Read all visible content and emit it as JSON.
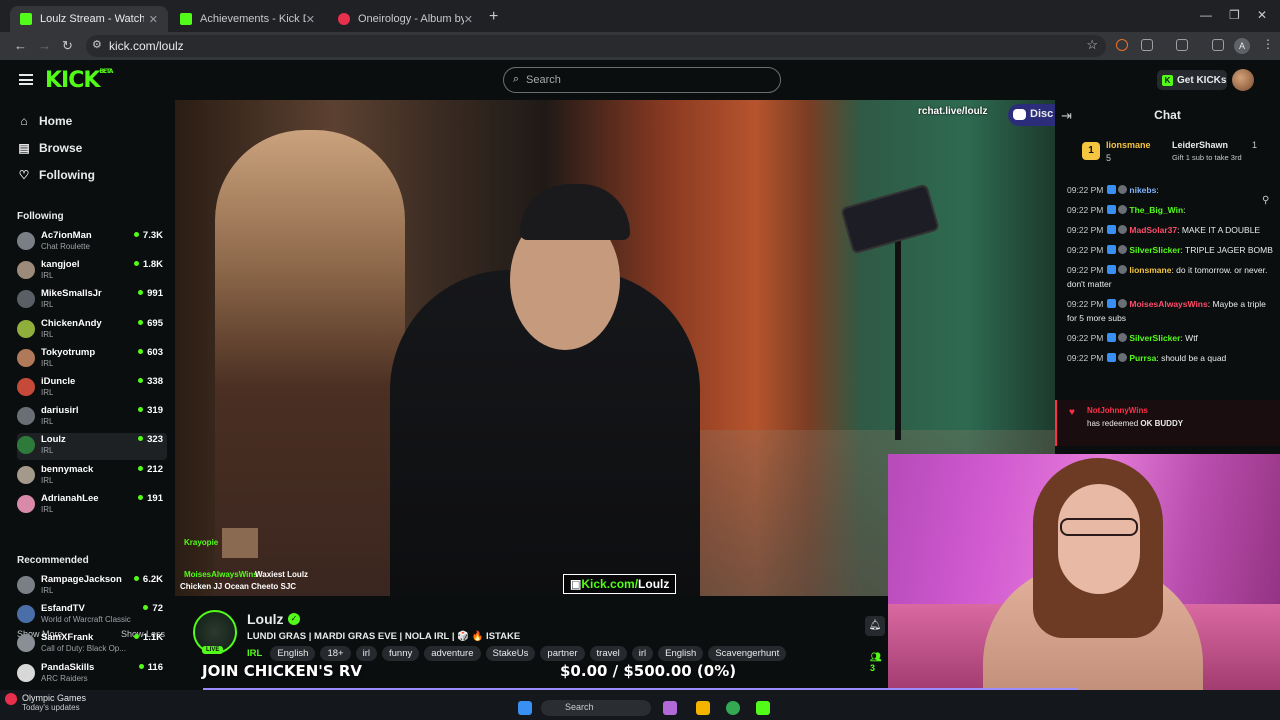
{
  "browser": {
    "tabs": [
      {
        "title": "Loulz Stream - Watch Live on Kick",
        "active": true,
        "favicon_color": "#53fc18"
      },
      {
        "title": "Achievements - Kick Dashboard",
        "active": false,
        "favicon_color": "#53fc18"
      },
      {
        "title": "Oneirology - Album by Cunninlynguists",
        "active": false,
        "favicon_color": "#e8304c"
      }
    ],
    "new_tab": "+",
    "url": "kick.com/loulz",
    "profile_initial": "A"
  },
  "header": {
    "logo": "KICK",
    "logo_badge": "BETA",
    "search_placeholder": "Search",
    "get_kicks_label": "Get KICKs"
  },
  "sidebar": {
    "nav": [
      {
        "label": "Home",
        "icon": "home-icon"
      },
      {
        "label": "Browse",
        "icon": "browse-icon"
      },
      {
        "label": "Following",
        "icon": "heart-icon"
      }
    ],
    "following_title": "Following",
    "following": [
      {
        "name": "Ac7ionMan",
        "category": "Chat Roulette",
        "viewers": "7.3K",
        "color": "#7a7f86"
      },
      {
        "name": "kangjoel",
        "category": "IRL",
        "viewers": "1.8K",
        "color": "#9c8a7a"
      },
      {
        "name": "MikeSmallsJr",
        "category": "IRL",
        "viewers": "991",
        "color": "#5a5f66"
      },
      {
        "name": "ChickenAndy",
        "category": "IRL",
        "viewers": "695",
        "color": "#8fae3c"
      },
      {
        "name": "Tokyotrump",
        "category": "IRL",
        "viewers": "603",
        "color": "#b07a5a"
      },
      {
        "name": "iDuncle",
        "category": "IRL",
        "viewers": "338",
        "color": "#c64a3a"
      },
      {
        "name": "dariusirl",
        "category": "IRL",
        "viewers": "319",
        "color": "#6a6f75"
      },
      {
        "name": "Loulz",
        "category": "IRL",
        "viewers": "323",
        "color": "#2e7a3a",
        "selected": true
      },
      {
        "name": "bennymack",
        "category": "IRL",
        "viewers": "212",
        "color": "#a49a8c"
      },
      {
        "name": "AdrianahLee",
        "category": "IRL",
        "viewers": "191",
        "color": "#d98aa8"
      }
    ],
    "show_more": "Show More",
    "show_less": "Show Less",
    "recommended_title": "Recommended",
    "recommended": [
      {
        "name": "RampageJackson",
        "category": "IRL",
        "viewers": "6.2K",
        "color": "#7a7f86"
      },
      {
        "name": "EsfandTV",
        "category": "World of Warcraft Classic",
        "viewers": "72",
        "color": "#4a6fa8"
      },
      {
        "name": "SamXFrank",
        "category": "Call of Duty: Black Op...",
        "viewers": "1.1K",
        "color": "#8a8f96"
      },
      {
        "name": "PandaSkills",
        "category": "ARC Raiders",
        "viewers": "116",
        "color": "#d8d8d8"
      }
    ]
  },
  "video": {
    "rchat_label": "rchat.live/loulz",
    "discord_label": "Disc",
    "kick_tag_prefix": "Kick.com/",
    "kick_tag_name": "Loulz",
    "alert_user": "Krayopie",
    "alert_winner": "MoisesAlwaysWins",
    "alert_line1": "Waxiest Loulz",
    "alert_line2": "Chicken JJ Ocean Cheeto SJC"
  },
  "stream": {
    "name": "Loulz",
    "live_badge": "LIVE",
    "title": "LUNDI GRAS | MARDI GRAS EVE | NOLA IRL | 🎲 🔥 ISTAKE",
    "category": "IRL",
    "tags": [
      "English",
      "18+",
      "irl",
      "funny",
      "adventure",
      "StakeUs",
      "partner",
      "travel",
      "irl",
      "English",
      "Scavengerhunt"
    ],
    "viewer_count": "3",
    "banner_left": "JOIN CHICKEN'S RV",
    "banner_right": "$0.00 / $500.00 (0%)",
    "goal_progress_fraction": 0.0
  },
  "chat": {
    "title": "Chat",
    "pinned_gifter": "lionsmane",
    "pinned_gifter_count": "5",
    "pinned_leader": "LeiderShawn",
    "pinned_leader_count": "1",
    "pinned_note": "Gift 1 sub to take 3rd",
    "messages": [
      {
        "time": "09:22 PM",
        "user": "nikebs",
        "user_color": "#7fb3ff",
        "text": ""
      },
      {
        "time": "09:22 PM",
        "user": "The_Big_Win",
        "user_color": "#53fc18",
        "text": ""
      },
      {
        "time": "09:22 PM",
        "user": "MadSolar37",
        "user_color": "#ff4d6a",
        "text": "MAKE IT A DOUBLE"
      },
      {
        "time": "09:22 PM",
        "user": "SilverSlicker",
        "user_color": "#53fc18",
        "text": "TRIPLE JAGER BOMB"
      },
      {
        "time": "09:22 PM",
        "user": "lionsmane",
        "user_color": "#f5c542",
        "text": "do it tomorrow. or never. don't matter"
      },
      {
        "time": "09:22 PM",
        "user": "MoisesAlwaysWins",
        "user_color": "#ff4d6a",
        "text": "Maybe a triple for 5 more subs"
      },
      {
        "time": "09:22 PM",
        "user": "SilverSlicker",
        "user_color": "#53fc18",
        "text": "Wtf"
      },
      {
        "time": "09:22 PM",
        "user": "Purrsa",
        "user_color": "#53fc18",
        "text": "should be a quad"
      }
    ],
    "redeem_user": "NotJohnnyWins",
    "redeem_text": "has redeemed",
    "redeem_reward": "OK BUDDY"
  },
  "taskbar": {
    "weather_title": "Olympic Games",
    "weather_sub": "Today's updates",
    "search_placeholder": "Search"
  },
  "colors": {
    "accent": "#53fc18",
    "bg": "#0b0e0f",
    "goal_border": "#9b8cff"
  }
}
